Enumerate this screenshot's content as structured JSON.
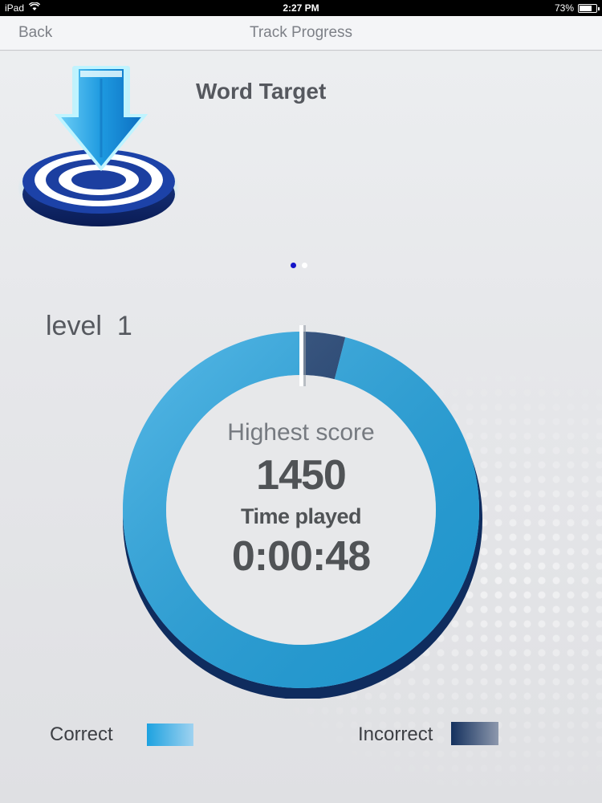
{
  "status_bar": {
    "device": "iPad",
    "time": "2:27 PM",
    "battery_percent": "73%",
    "battery_level": 0.73,
    "icons": [
      "wifi-icon",
      "battery-icon"
    ]
  },
  "nav": {
    "back_label": "Back",
    "title": "Track Progress"
  },
  "app": {
    "name": "Word Target",
    "icon": "arrow-target-icon",
    "colors": {
      "arrow": "#1a9de0",
      "target_outer": "#1e3c8c",
      "glow": "#5fe0f5"
    }
  },
  "pager": {
    "pages": 2,
    "active_index": 0,
    "active_color": "#1414c8",
    "inactive_color": "#ffffff"
  },
  "level": {
    "label": "level  1"
  },
  "stats": {
    "highest_score_label": "Highest score",
    "highest_score_value": "1450",
    "time_played_label": "Time played",
    "time_played_value": "0:00:48"
  },
  "chart_data": {
    "type": "pie",
    "categories": [
      "Correct",
      "Incorrect"
    ],
    "values": [
      96,
      4
    ],
    "colors": [
      "#21a4e2",
      "#163a6e"
    ],
    "legend_placement": "bottom"
  },
  "legend": {
    "correct_label": "Correct",
    "correct_color": "#21a4e2",
    "incorrect_label": "Incorrect",
    "incorrect_color": "#163a6e"
  }
}
